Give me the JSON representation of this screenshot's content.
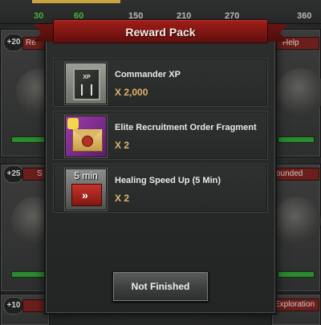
{
  "background": {
    "progress_ticks": [
      {
        "label": "30",
        "active": true
      },
      {
        "label": "60",
        "active": true
      },
      {
        "label": "150",
        "active": false
      },
      {
        "label": "210",
        "active": false
      },
      {
        "label": "270",
        "active": false
      },
      {
        "label": "360",
        "active": false
      }
    ],
    "cards": {
      "top_left_badge": "+20",
      "top_left_label": "Re",
      "top_right_label": "Help",
      "mid_left_badge": "+25",
      "mid_left_label": "S",
      "mid_right_label": "ounded",
      "bottom_left_badge": "+10",
      "bottom_right_label": "Exploration"
    }
  },
  "modal": {
    "title": "Reward Pack",
    "items": [
      {
        "name": "Commander XP",
        "quantity": "X 2,000",
        "icon": "commander-xp-book-icon",
        "icon_text": "XP"
      },
      {
        "name": "Elite Recruitment Order Fragment",
        "quantity": "X 2",
        "icon": "elite-recruitment-fragment-icon"
      },
      {
        "name": "Healing Speed Up (5 Min)",
        "quantity": "X 2",
        "icon": "healing-speedup-icon",
        "icon_text": "5 min"
      }
    ],
    "button_label": "Not Finished"
  },
  "colors": {
    "banner_red": "#8a1a16",
    "quantity_gold": "#e2b36a",
    "progress_green": "#47b13a"
  }
}
